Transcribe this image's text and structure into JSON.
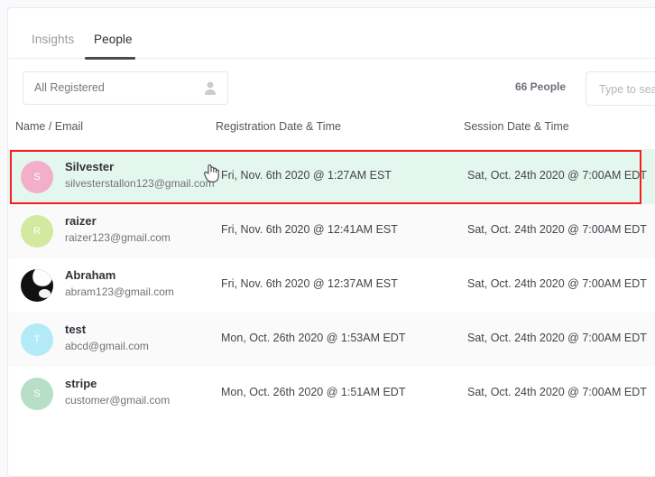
{
  "tabs": [
    {
      "label": "Insights",
      "active": false
    },
    {
      "label": "People",
      "active": true
    }
  ],
  "toolbar": {
    "filter_value": "All Registered",
    "filter_icon": "person-icon",
    "people_count": "66 People",
    "search_placeholder": "Type to search",
    "search_value": ""
  },
  "table": {
    "headers": {
      "name": "Name / Email",
      "registration": "Registration Date & Time",
      "session": "Session Date & Time"
    },
    "rows": [
      {
        "name": "Silvester",
        "email": "silvesterstallon123@gmail.com",
        "registration": "Fri, Nov. 6th 2020 @ 1:27AM EST",
        "session": "Sat, Oct. 24th 2020 @ 7:00AM EDT",
        "avatar_initial": "S",
        "avatar_color": "#f3aec9",
        "avatar_type": "initial",
        "highlighted": true
      },
      {
        "name": "raizer",
        "email": "raizer123@gmail.com",
        "registration": "Fri, Nov. 6th 2020 @ 12:41AM EST",
        "session": "Sat, Oct. 24th 2020 @ 7:00AM EDT",
        "avatar_initial": "R",
        "avatar_color": "#d4e9a0",
        "avatar_type": "initial",
        "highlighted": false
      },
      {
        "name": "Abraham",
        "email": "abram123@gmail.com",
        "registration": "Fri, Nov. 6th 2020 @ 12:37AM EST",
        "session": "Sat, Oct. 24th 2020 @ 7:00AM EDT",
        "avatar_initial": "",
        "avatar_color": "#111111",
        "avatar_type": "photo",
        "highlighted": false
      },
      {
        "name": "test",
        "email": "abcd@gmail.com",
        "registration": "Mon, Oct. 26th 2020 @ 1:53AM EDT",
        "session": "Sat, Oct. 24th 2020 @ 7:00AM EDT",
        "avatar_initial": "T",
        "avatar_color": "#b3eaf7",
        "avatar_type": "initial",
        "highlighted": false
      },
      {
        "name": "stripe",
        "email": "customer@gmail.com",
        "registration": "Mon, Oct. 26th 2020 @ 1:51AM EDT",
        "session": "Sat, Oct. 24th 2020 @ 7:00AM EDT",
        "avatar_initial": "S",
        "avatar_color": "#b7dec7",
        "avatar_type": "initial",
        "highlighted": false
      }
    ]
  },
  "annotation": {
    "highlight_color": "#f81d1d",
    "cursor_icon": "pointing-hand-cursor"
  }
}
